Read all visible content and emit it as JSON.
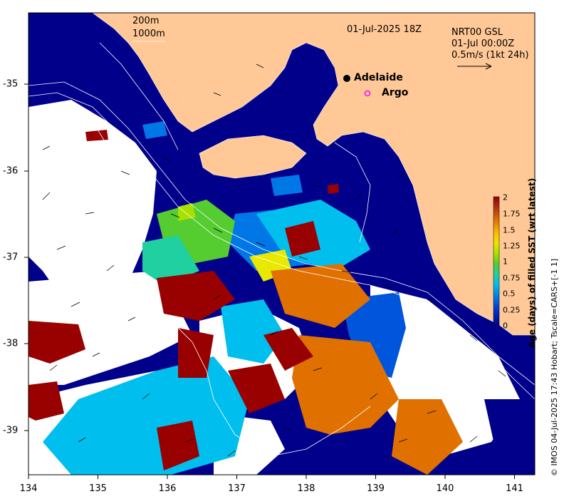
{
  "map": {
    "lon_range": [
      134,
      141.3
    ],
    "lat_range": [
      -39.5,
      -34.2
    ],
    "x_ticks": [
      134,
      135,
      136,
      137,
      138,
      139,
      140,
      141
    ],
    "y_ticks": [
      -35,
      -36,
      -37,
      -38,
      -39
    ],
    "contour_labels": [
      "200m",
      "1000m"
    ],
    "date_label": "01-Jul-2025 18Z",
    "product": [
      "NRT00 GSL",
      "01-Jul 00:00Z",
      "0.5m/s (1kt 24h)"
    ],
    "places": [
      {
        "name": "Adelaide",
        "lon": 138.6,
        "lat": -34.93,
        "marker": "filled-circle"
      },
      {
        "name": "Argo",
        "lon": 138.8,
        "lat": -35.1,
        "marker": "open-circle"
      }
    ],
    "colorbar": {
      "label": "Age (days) of filled SST (wrt latest)",
      "ticks": [
        "2",
        "1.75",
        "1.5",
        "1.25",
        "1",
        "0.75",
        "0.5",
        "0.25",
        "0"
      ],
      "colors": [
        "#00008b",
        "#0033cc",
        "#0077e6",
        "#00bfef",
        "#20d0a0",
        "#55cc30",
        "#a8e000",
        "#e8e800",
        "#ffbb00",
        "#e07000",
        "#b03010",
        "#990000"
      ]
    },
    "credit": "© IMOS 04-Jul-2025 17:43 Hobart; Tscale=CARS+[-1 1]",
    "colors": {
      "land": "#ffc896",
      "ocean": "#00008b",
      "nodata": "#ffffff",
      "argo": "#ff00ff"
    }
  }
}
